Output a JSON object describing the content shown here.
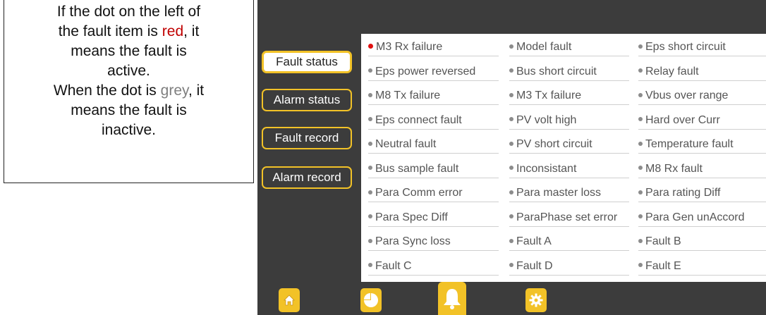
{
  "note": {
    "line1": "If the dot on the left of",
    "line2a": "the fault item is ",
    "line2b": "red",
    "line2c": ", it",
    "line3": "means the fault is",
    "line4": "active.",
    "line5a": "When the dot is ",
    "line5b": "grey",
    "line5c": ", it",
    "line6": "means the fault is",
    "line7": "inactive."
  },
  "sidebar": {
    "items": [
      {
        "label": "Fault status",
        "active": true
      },
      {
        "label": "Alarm status",
        "active": false
      },
      {
        "label": "Fault record",
        "active": false
      },
      {
        "label": "Alarm record",
        "active": false
      }
    ]
  },
  "faults": [
    [
      "M3 Rx failure",
      "Model fault",
      "Eps short circuit"
    ],
    [
      "Eps power reversed",
      "Bus short circuit",
      "Relay fault"
    ],
    [
      "M8 Tx failure",
      "M3 Tx failure",
      "Vbus over range"
    ],
    [
      "Eps connect fault",
      "PV volt high",
      "Hard over Curr"
    ],
    [
      "Neutral fault",
      "PV short circuit",
      "Temperature fault"
    ],
    [
      "Bus sample fault",
      "Inconsistant",
      "M8 Rx fault"
    ],
    [
      "Para Comm error",
      "Para master loss",
      "Para rating Diff"
    ],
    [
      "Para Spec Diff",
      "ParaPhase set error",
      "Para Gen unAccord"
    ],
    [
      "Para Sync loss",
      "Fault A",
      "Fault B"
    ],
    [
      "Fault C",
      "Fault D",
      "Fault E"
    ]
  ],
  "active_fault": "M3 Rx failure",
  "colors": {
    "active_dot": "#e01010",
    "inactive_dot": "#8c8c8c",
    "accent": "#f2c227",
    "screen_bg": "#3c3c3c"
  },
  "bottom_nav": [
    "home-icon",
    "pie-chart-icon",
    "bell-icon",
    "gear-icon"
  ]
}
